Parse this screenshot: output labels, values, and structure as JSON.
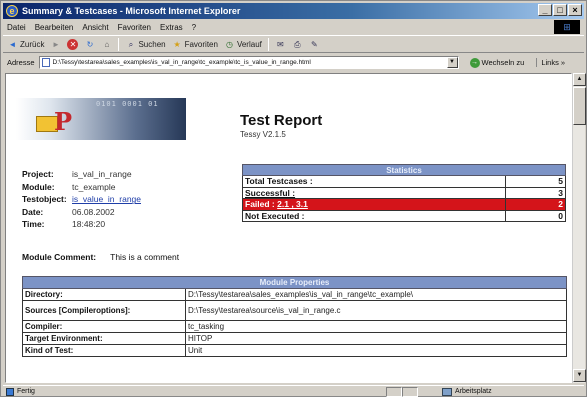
{
  "window": {
    "title": "Summary & Testcases - Microsoft Internet Explorer",
    "min": "_",
    "max": "□",
    "close": "×"
  },
  "menu": [
    "Datei",
    "Bearbeiten",
    "Ansicht",
    "Favoriten",
    "Extras",
    "?"
  ],
  "toolbar": {
    "back": "Zurück",
    "search": "Suchen",
    "favorites": "Favoriten",
    "history": "Verlauf"
  },
  "address": {
    "label": "Adresse",
    "value": "D:\\Tessy\\testarea\\sales_examples\\is_val_in_range\\tc_example\\tc_is_value_in_range.html",
    "go": "Wechseln zu",
    "links": "Links »"
  },
  "status": {
    "left": "Fertig",
    "right": "Arbeitsplatz"
  },
  "report": {
    "title": "Test Report",
    "subtitle": "Tessy V2.1.5",
    "banner_binary": "0101 0001 01"
  },
  "info": [
    {
      "label": "Project:",
      "value": "is_val_in_range"
    },
    {
      "label": "Module:",
      "value": "tc_example"
    },
    {
      "label": "Testobject:",
      "value": "is_value_in_range"
    },
    {
      "label": "Date:",
      "value": "06.08.2002"
    },
    {
      "label": "Time:",
      "value": "18:48:20"
    }
  ],
  "statistics": {
    "header": "Statistics",
    "rows": [
      {
        "label": "Total Testcases :",
        "value": "5"
      },
      {
        "label": "Successful :",
        "value": "3"
      },
      {
        "label": "Failed :",
        "links": "2.1 , 3.1",
        "value": "2"
      },
      {
        "label": "Not Executed :",
        "value": "0"
      }
    ]
  },
  "module_comment": {
    "label": "Module Comment:",
    "value": "This is a comment"
  },
  "module_properties": {
    "header": "Module Properties",
    "rows": [
      {
        "key": "Directory:",
        "value": "D:\\Tessy\\testarea\\sales_examples\\is_val_in_range\\tc_example\\"
      },
      {
        "key": "Sources [Compileroptions]:",
        "value": "D:\\Tessy\\testarea\\source\\is_val_in_range.c"
      },
      {
        "key": "Compiler:",
        "value": "tc_tasking"
      },
      {
        "key": "Target Environment:",
        "value": "HITOP"
      },
      {
        "key": "Kind of Test:",
        "value": "Unit"
      }
    ]
  },
  "colors": {
    "title_gradient_start": "#0a246a",
    "table_header": "#7c93c6",
    "failed_row": "#d4141a",
    "link": "#1f3ea8"
  }
}
